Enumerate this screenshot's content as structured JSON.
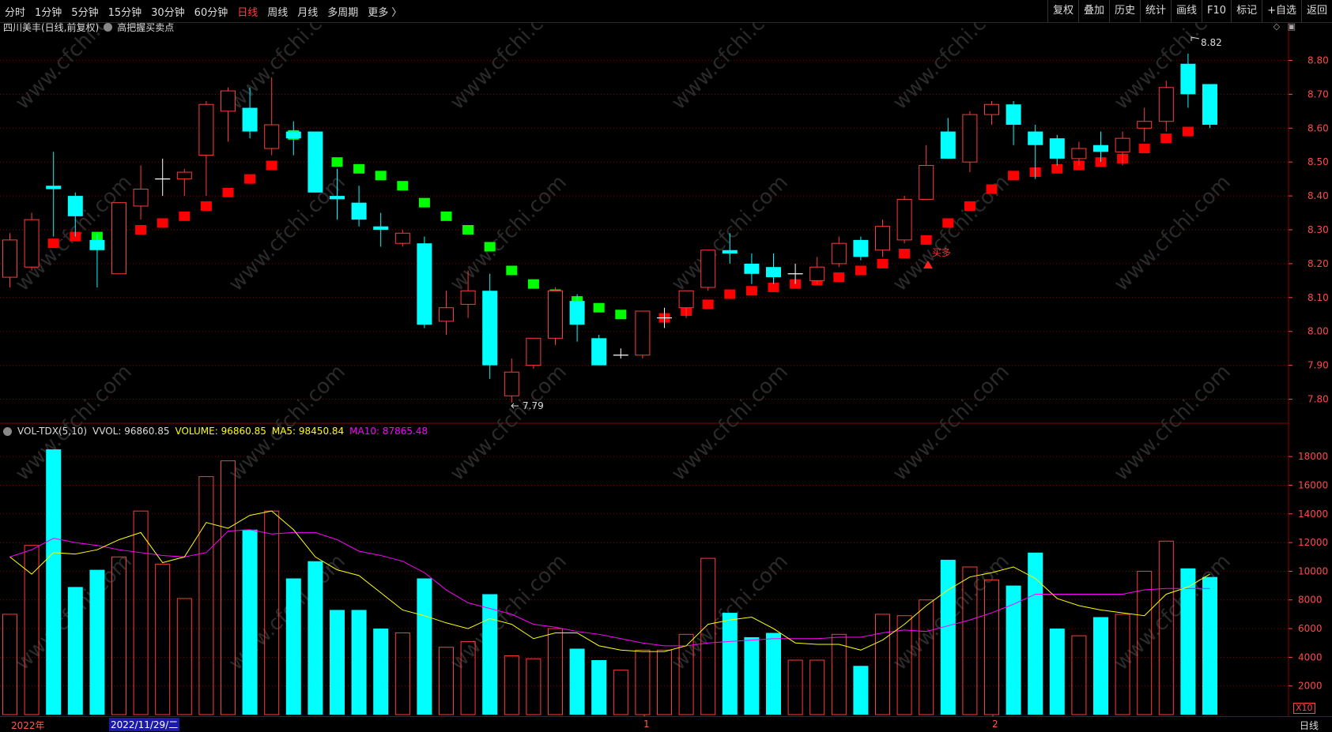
{
  "toolbar": {
    "periods": [
      "分时",
      "1分钟",
      "5分钟",
      "15分钟",
      "30分钟",
      "60分钟",
      "日线",
      "周线",
      "月线",
      "多周期",
      "更多 〉"
    ],
    "active_period": "日线",
    "right_buttons": [
      "复权",
      "叠加",
      "历史",
      "统计",
      "画线",
      "F10",
      "标记",
      "+自选",
      "返回"
    ]
  },
  "header": {
    "stock_title": "四川美丰(日线,前复权)",
    "indicator_name": "高把握买卖点"
  },
  "annotations": {
    "high_label": "8.82",
    "low_label": "7.79",
    "signal_label": "买多"
  },
  "volume_header": {
    "name": "VOL-TDX(5,10)",
    "vvol": "VVOL: 96860.85",
    "volume": "VOLUME: 96860.85",
    "ma5": "MA5: 98450.84",
    "ma10": "MA10: 87865.48"
  },
  "volume_unit": "X10",
  "bottom": {
    "year_label": "2022年",
    "cursor_date": "2022/11/29/二",
    "month1": "1",
    "month2": "2",
    "period": "日线"
  },
  "colors": {
    "up": "#ff3b3b",
    "down": "#00ffff",
    "ma5": "#ffff00",
    "ma10": "#ff00ff",
    "sar_up": "#ff0000",
    "sar_down": "#00ff00",
    "grid": "#8b0000"
  },
  "chart_data": [
    {
      "type": "candlestick",
      "title": "四川美丰(日线,前复权)",
      "y_ticks": [
        8.8,
        8.7,
        8.6,
        8.5,
        8.4,
        8.3,
        8.2,
        8.1,
        8.0,
        7.9,
        7.8
      ],
      "ylim": [
        7.75,
        8.85
      ],
      "candles": [
        {
          "o": 8.16,
          "h": 8.29,
          "l": 8.13,
          "c": 8.27
        },
        {
          "o": 8.19,
          "h": 8.35,
          "l": 8.18,
          "c": 8.33
        },
        {
          "o": 8.43,
          "h": 8.53,
          "l": 8.28,
          "c": 8.42
        },
        {
          "o": 8.4,
          "h": 8.41,
          "l": 8.28,
          "c": 8.34
        },
        {
          "o": 8.27,
          "h": 8.29,
          "l": 8.13,
          "c": 8.24
        },
        {
          "o": 8.17,
          "h": 8.38,
          "l": 8.17,
          "c": 8.38
        },
        {
          "o": 8.37,
          "h": 8.49,
          "l": 8.33,
          "c": 8.42
        },
        {
          "o": 8.45,
          "h": 8.51,
          "l": 8.4,
          "c": 8.45
        },
        {
          "o": 8.45,
          "h": 8.48,
          "l": 8.4,
          "c": 8.47
        },
        {
          "o": 8.52,
          "h": 8.68,
          "l": 8.4,
          "c": 8.67
        },
        {
          "o": 8.65,
          "h": 8.72,
          "l": 8.56,
          "c": 8.71
        },
        {
          "o": 8.66,
          "h": 8.72,
          "l": 8.57,
          "c": 8.59
        },
        {
          "o": 8.54,
          "h": 8.75,
          "l": 8.52,
          "c": 8.61
        },
        {
          "o": 8.59,
          "h": 8.62,
          "l": 8.52,
          "c": 8.57
        },
        {
          "o": 8.59,
          "h": 8.59,
          "l": 8.41,
          "c": 8.41
        },
        {
          "o": 8.4,
          "h": 8.48,
          "l": 8.33,
          "c": 8.39
        },
        {
          "o": 8.38,
          "h": 8.43,
          "l": 8.31,
          "c": 8.33
        },
        {
          "o": 8.31,
          "h": 8.35,
          "l": 8.25,
          "c": 8.3
        },
        {
          "o": 8.26,
          "h": 8.3,
          "l": 8.25,
          "c": 8.29
        },
        {
          "o": 8.26,
          "h": 8.28,
          "l": 8.01,
          "c": 8.02
        },
        {
          "o": 8.03,
          "h": 8.12,
          "l": 7.99,
          "c": 8.07
        },
        {
          "o": 8.08,
          "h": 8.18,
          "l": 8.04,
          "c": 8.12
        },
        {
          "o": 8.12,
          "h": 8.17,
          "l": 7.86,
          "c": 7.9
        },
        {
          "o": 7.81,
          "h": 7.92,
          "l": 7.79,
          "c": 7.88
        },
        {
          "o": 7.9,
          "h": 7.98,
          "l": 7.89,
          "c": 7.98
        },
        {
          "o": 7.98,
          "h": 8.13,
          "l": 7.96,
          "c": 8.12
        },
        {
          "o": 8.09,
          "h": 8.11,
          "l": 7.97,
          "c": 8.02
        },
        {
          "o": 7.98,
          "h": 7.99,
          "l": 7.9,
          "c": 7.9
        },
        {
          "o": 7.93,
          "h": 7.95,
          "l": 7.92,
          "c": 7.93
        },
        {
          "o": 7.93,
          "h": 8.06,
          "l": 7.92,
          "c": 8.06
        },
        {
          "o": 8.04,
          "h": 8.07,
          "l": 8.01,
          "c": 8.04
        },
        {
          "o": 8.07,
          "h": 8.12,
          "l": 8.04,
          "c": 8.12
        },
        {
          "o": 8.13,
          "h": 8.24,
          "l": 8.12,
          "c": 8.24
        },
        {
          "o": 8.24,
          "h": 8.29,
          "l": 8.2,
          "c": 8.23
        },
        {
          "o": 8.2,
          "h": 8.23,
          "l": 8.14,
          "c": 8.17
        },
        {
          "o": 8.19,
          "h": 8.23,
          "l": 8.14,
          "c": 8.16
        },
        {
          "o": 8.17,
          "h": 8.2,
          "l": 8.14,
          "c": 8.17
        },
        {
          "o": 8.15,
          "h": 8.22,
          "l": 8.14,
          "c": 8.19
        },
        {
          "o": 8.2,
          "h": 8.28,
          "l": 8.19,
          "c": 8.26
        },
        {
          "o": 8.27,
          "h": 8.28,
          "l": 8.21,
          "c": 8.22
        },
        {
          "o": 8.24,
          "h": 8.33,
          "l": 8.22,
          "c": 8.31
        },
        {
          "o": 8.27,
          "h": 8.4,
          "l": 8.26,
          "c": 8.39
        },
        {
          "o": 8.39,
          "h": 8.55,
          "l": 8.39,
          "c": 8.49
        },
        {
          "o": 8.59,
          "h": 8.63,
          "l": 8.51,
          "c": 8.51
        },
        {
          "o": 8.5,
          "h": 8.65,
          "l": 8.47,
          "c": 8.64
        },
        {
          "o": 8.64,
          "h": 8.68,
          "l": 8.61,
          "c": 8.67
        },
        {
          "o": 8.67,
          "h": 8.68,
          "l": 8.55,
          "c": 8.61
        },
        {
          "o": 8.59,
          "h": 8.61,
          "l": 8.45,
          "c": 8.55
        },
        {
          "o": 8.57,
          "h": 8.58,
          "l": 8.49,
          "c": 8.51
        },
        {
          "o": 8.51,
          "h": 8.56,
          "l": 8.49,
          "c": 8.54
        },
        {
          "o": 8.55,
          "h": 8.59,
          "l": 8.5,
          "c": 8.53
        },
        {
          "o": 8.53,
          "h": 8.59,
          "l": 8.49,
          "c": 8.57
        },
        {
          "o": 8.6,
          "h": 8.66,
          "l": 8.56,
          "c": 8.62
        },
        {
          "o": 8.62,
          "h": 8.74,
          "l": 8.59,
          "c": 8.72
        },
        {
          "o": 8.79,
          "h": 8.82,
          "l": 8.66,
          "c": 8.7
        },
        {
          "o": 8.73,
          "h": 8.73,
          "l": 8.6,
          "c": 8.61
        }
      ],
      "sar": [
        {
          "v": 8.24,
          "s": "up"
        },
        {
          "v": 8.24,
          "s": "up"
        },
        {
          "v": 8.26,
          "s": "up"
        },
        {
          "v": 8.28,
          "s": "up"
        },
        {
          "v": 8.28,
          "s": "down"
        },
        {
          "v": 8.28,
          "s": "up"
        },
        {
          "v": 8.3,
          "s": "up"
        },
        {
          "v": 8.32,
          "s": "up"
        },
        {
          "v": 8.34,
          "s": "up"
        },
        {
          "v": 8.37,
          "s": "up"
        },
        {
          "v": 8.41,
          "s": "up"
        },
        {
          "v": 8.45,
          "s": "up"
        },
        {
          "v": 8.49,
          "s": "up"
        },
        {
          "v": 8.58,
          "s": "down"
        },
        {
          "v": 8.51,
          "s": "down"
        },
        {
          "v": 8.5,
          "s": "down"
        },
        {
          "v": 8.48,
          "s": "down"
        },
        {
          "v": 8.46,
          "s": "down"
        },
        {
          "v": 8.43,
          "s": "down"
        },
        {
          "v": 8.38,
          "s": "down"
        },
        {
          "v": 8.34,
          "s": "down"
        },
        {
          "v": 8.3,
          "s": "down"
        },
        {
          "v": 8.25,
          "s": "down"
        },
        {
          "v": 8.18,
          "s": "down"
        },
        {
          "v": 8.14,
          "s": "down"
        },
        {
          "v": 8.11,
          "s": "down"
        },
        {
          "v": 8.09,
          "s": "down"
        },
        {
          "v": 8.07,
          "s": "down"
        },
        {
          "v": 8.05,
          "s": "down"
        },
        {
          "v": 8.04,
          "s": "down"
        },
        {
          "v": 8.04,
          "s": "up"
        },
        {
          "v": 8.06,
          "s": "up"
        },
        {
          "v": 8.08,
          "s": "up"
        },
        {
          "v": 8.11,
          "s": "up"
        },
        {
          "v": 8.12,
          "s": "up"
        },
        {
          "v": 8.13,
          "s": "up"
        },
        {
          "v": 8.14,
          "s": "up"
        },
        {
          "v": 8.15,
          "s": "up"
        },
        {
          "v": 8.16,
          "s": "up"
        },
        {
          "v": 8.18,
          "s": "up"
        },
        {
          "v": 8.2,
          "s": "up"
        },
        {
          "v": 8.23,
          "s": "up"
        },
        {
          "v": 8.27,
          "s": "up"
        },
        {
          "v": 8.32,
          "s": "up"
        },
        {
          "v": 8.37,
          "s": "up"
        },
        {
          "v": 8.42,
          "s": "up"
        },
        {
          "v": 8.46,
          "s": "up"
        },
        {
          "v": 8.47,
          "s": "up"
        },
        {
          "v": 8.48,
          "s": "up"
        },
        {
          "v": 8.49,
          "s": "up"
        },
        {
          "v": 8.5,
          "s": "up"
        },
        {
          "v": 8.51,
          "s": "up"
        },
        {
          "v": 8.54,
          "s": "up"
        },
        {
          "v": 8.57,
          "s": "up"
        },
        {
          "v": 8.59,
          "s": "up"
        }
      ]
    },
    {
      "type": "bar",
      "title": "VOL-TDX(5,10)",
      "y_ticks": [
        18000,
        16000,
        14000,
        12000,
        10000,
        8000,
        6000,
        4000,
        2000
      ],
      "ylim": [
        0,
        19000
      ],
      "volume": [
        7000,
        11800,
        18500,
        8900,
        10100,
        11000,
        14200,
        10500,
        8100,
        16600,
        17700,
        12900,
        14200,
        9500,
        10700,
        7300,
        7300,
        6000,
        5700,
        9500,
        4700,
        5100,
        8400,
        4100,
        3900,
        6000,
        4600,
        3800,
        3100,
        4500,
        4500,
        5600,
        10900,
        7100,
        5400,
        5700,
        3800,
        3800,
        5600,
        3400,
        7000,
        6900,
        8000,
        10800,
        10300,
        9400,
        9000,
        11300,
        6000,
        5500,
        6800,
        7000,
        10000,
        12100,
        10200,
        9600
      ],
      "ma5": [
        11000,
        9800,
        11300,
        11200,
        11500,
        12200,
        12700,
        10600,
        11000,
        13400,
        13000,
        13900,
        14200,
        12900,
        11000,
        10100,
        9700,
        8500,
        7300,
        6900,
        6400,
        6000,
        6700,
        6300,
        5300,
        5700,
        5700,
        4800,
        4500,
        4400,
        4400,
        4800,
        6300,
        6600,
        6800,
        6000,
        5000,
        4900,
        4900,
        4500,
        5200,
        6300,
        7600,
        8700,
        9600,
        9900,
        10300,
        9500,
        8100,
        7600,
        7300,
        7100,
        6900,
        8400,
        8900,
        9800
      ],
      "ma10": [
        11000,
        11500,
        12300,
        12000,
        11800,
        11500,
        11300,
        11100,
        11000,
        11300,
        12800,
        12900,
        12600,
        12700,
        12700,
        12200,
        11400,
        11100,
        10700,
        9900,
        8700,
        7800,
        7400,
        7000,
        6300,
        6100,
        5800,
        5600,
        5300,
        5000,
        4800,
        4800,
        5000,
        5100,
        5200,
        5300,
        5300,
        5300,
        5400,
        5400,
        5700,
        5900,
        5800,
        6200,
        6600,
        7100,
        7700,
        8400,
        8400,
        8400,
        8400,
        8400,
        8700,
        8800,
        8800,
        8800
      ]
    }
  ]
}
